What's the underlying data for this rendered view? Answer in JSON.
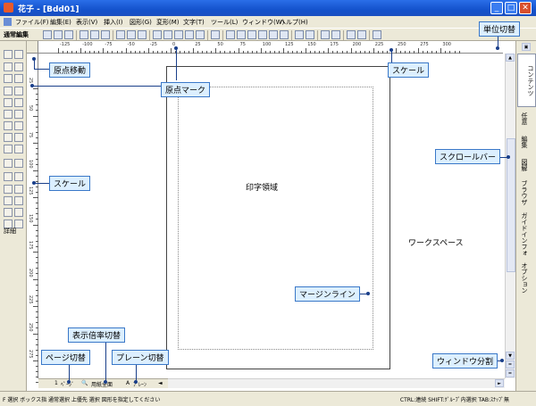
{
  "window": {
    "title": "花子 - [Bdd01]",
    "minimize": "_",
    "maximize": "□",
    "close": "✕"
  },
  "menu": [
    "ファイル(F)",
    "編集(E)",
    "表示(V)",
    "挿入(I)",
    "図形(G)",
    "変形(M)",
    "文字(T)",
    "ツール(L)",
    "ウィンドウ(W)",
    "ヘルプ(H)"
  ],
  "toolbar": {
    "mode_label": "通常編集"
  },
  "palette": {
    "detail_label": "詳細"
  },
  "ruler": {
    "h_ticks": [
      "-125",
      "-100",
      "-75",
      "-50",
      "-25",
      "0",
      "25",
      "50",
      "75",
      "100",
      "125",
      "150",
      "175",
      "200",
      "225",
      "250",
      "275",
      "300"
    ],
    "v_ticks": [
      "25",
      "50",
      "75",
      "100",
      "125",
      "150",
      "175",
      "200",
      "225",
      "250",
      "275"
    ]
  },
  "workspace": {
    "print_area": "印字領域",
    "workspace_label": "ワークスペース"
  },
  "side_tabs": [
    "コンテンツ",
    "任意",
    "編集",
    "図解",
    "ブラウザ",
    "ガイドインフォ",
    "オプション"
  ],
  "page_strip": [
    "1",
    "ﾍﾟｰｼﾞ",
    "用紙全面",
    "A",
    "ﾌﾟﾚｰﾝ"
  ],
  "status": {
    "left": "F 選択 ボックス指 通常選択 上優先 選択 図形を指定してください",
    "right": "CTRL:連続 SHIFT:ｸﾞﾙｰﾌﾟ内選択 TAB:ｽﾅｯﾌﾟ無"
  },
  "annotations": {
    "origin_move": "原点移動",
    "origin_mark": "原点マーク",
    "scale_top": "スケール",
    "scale_left": "スケール",
    "unit_switch": "単位切替",
    "scrollbar": "スクロールバー",
    "margin_line": "マージンライン",
    "zoom_switch": "表示倍率切替",
    "page_switch": "ページ切替",
    "plane_switch": "プレーン切替",
    "window_split": "ウィンドウ分割"
  }
}
